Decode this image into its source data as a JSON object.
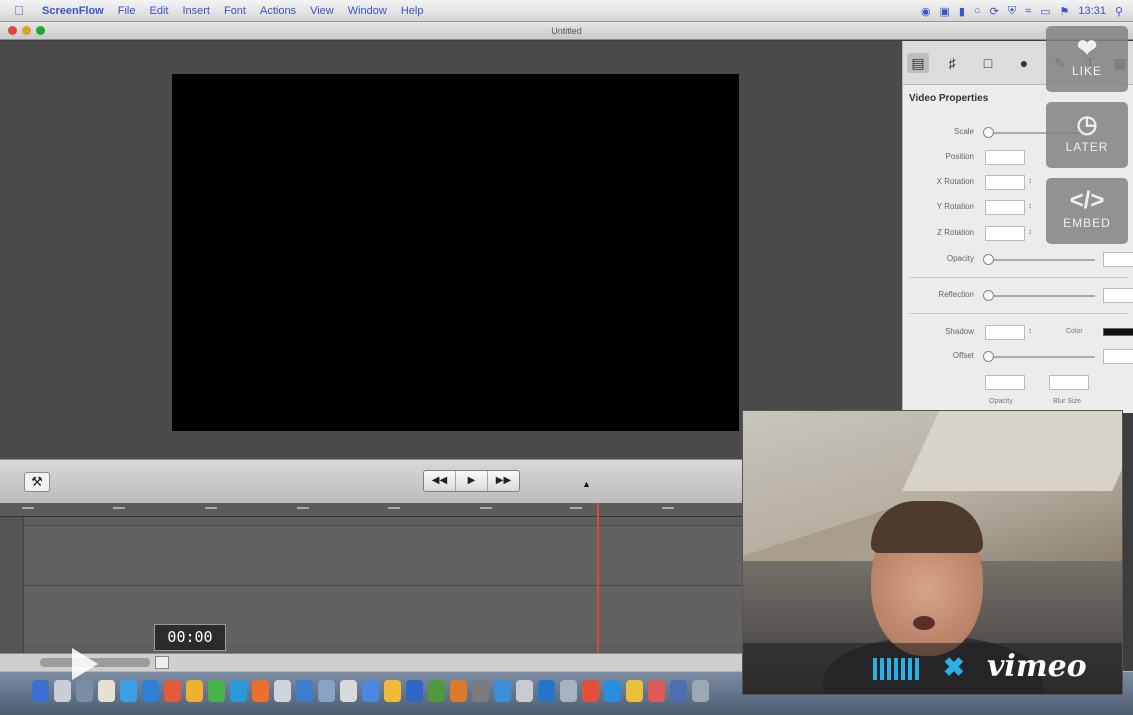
{
  "menubar": {
    "apple_icon": "apple-icon",
    "app_name": "ScreenFlow",
    "items": [
      "File",
      "Edit",
      "Insert",
      "Font",
      "Actions",
      "View",
      "Window",
      "Help"
    ],
    "clock": "13:31"
  },
  "window": {
    "title": "Untitled"
  },
  "properties": {
    "section_title": "Video Properties",
    "labels": {
      "scale": "Scale",
      "position": "Position",
      "x_rotation": "X Rotation",
      "y_rotation": "Y Rotation",
      "z_rotation": "Z Rotation",
      "opacity": "Opacity",
      "reflection": "Reflection",
      "shadow": "Shadow",
      "color": "Color",
      "offset": "Offset",
      "opacity_small": "Opacity",
      "blur_size": "Blur Size"
    }
  },
  "vimeo_buttons": {
    "like": {
      "label": "LIKE",
      "icon": "heart-icon"
    },
    "later": {
      "label": "LATER",
      "icon": "clock-icon"
    },
    "embed": {
      "label": "EMBED",
      "icon_text": "</>"
    }
  },
  "player": {
    "timecode": "00:00",
    "vimeo_logo": "vimeo"
  },
  "colors": {
    "accent_blue": "#2ab0e5",
    "playhead": "#d54a3a"
  }
}
